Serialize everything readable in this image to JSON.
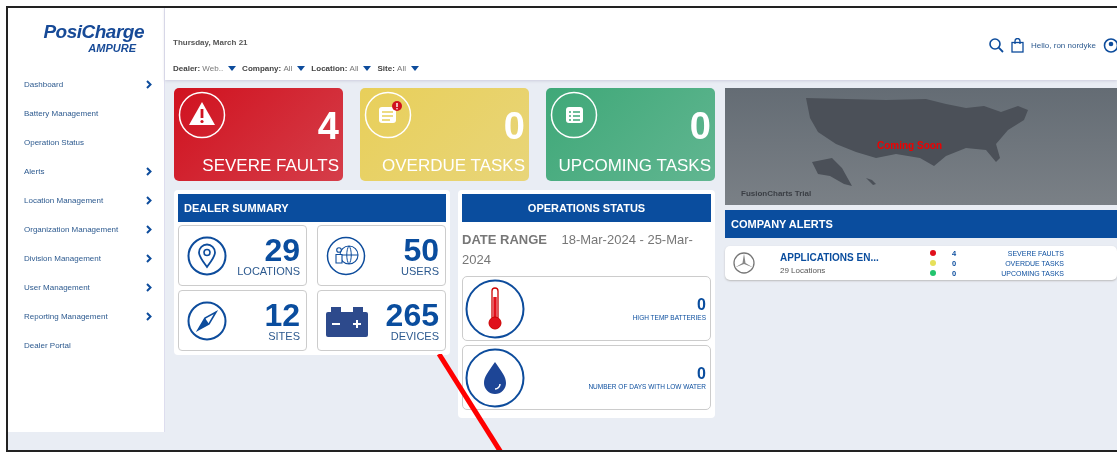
{
  "logo": {
    "brand": "PosiCharge",
    "sub": "AMPURE"
  },
  "sidebar": {
    "items": [
      {
        "label": "Dashboard",
        "expandable": true
      },
      {
        "label": "Battery Management",
        "expandable": false
      },
      {
        "label": "Operation Status",
        "expandable": false
      },
      {
        "label": "Alerts",
        "expandable": true
      },
      {
        "label": "Location Management",
        "expandable": true
      },
      {
        "label": "Organization Management",
        "expandable": true
      },
      {
        "label": "Division Management",
        "expandable": true
      },
      {
        "label": "User Management",
        "expandable": true
      },
      {
        "label": "Reporting Management",
        "expandable": true
      },
      {
        "label": "Dealer Portal",
        "expandable": false
      }
    ]
  },
  "header": {
    "date": "Thursday, March 21",
    "greeting": "Hello, ron nordyke",
    "filters": [
      {
        "label": "Dealer:",
        "value": "Web.."
      },
      {
        "label": "Company:",
        "value": "All"
      },
      {
        "label": "Location:",
        "value": "All"
      },
      {
        "label": "Site:",
        "value": "All"
      }
    ]
  },
  "tiles": [
    {
      "kind": "fault",
      "count": "4",
      "label": "SEVERE FAULTS",
      "color": "#d0121f"
    },
    {
      "kind": "overdue",
      "count": "0",
      "label": "OVERDUE TASKS",
      "color": "#e8cf5a"
    },
    {
      "kind": "upcoming",
      "count": "0",
      "label": "UPCOMING TASKS",
      "color": "#3fa878"
    }
  ],
  "dealer_summary": {
    "title": "DEALER SUMMARY",
    "stats": [
      {
        "kind": "location",
        "value": "29",
        "label": "LOCATIONS"
      },
      {
        "kind": "users",
        "value": "50",
        "label": "USERS"
      },
      {
        "kind": "site",
        "value": "12",
        "label": "SITES"
      },
      {
        "kind": "device",
        "value": "265",
        "label": "DEVICES"
      }
    ]
  },
  "operations_status": {
    "title": "OPERATIONS STATUS",
    "date_range_label": "DATE RANGE",
    "date_range_value": "18-Mar-2024 - 25-Mar-2024",
    "metrics": [
      {
        "kind": "temperature",
        "value": "0",
        "label": "HIGH TEMP BATTERIES"
      },
      {
        "kind": "water",
        "value": "0",
        "label": "NUMBER OF DAYS WITH LOW WATER"
      }
    ]
  },
  "map": {
    "message": "Coming Soon",
    "credit": "FusionCharts Trial"
  },
  "company_alerts": {
    "title": "COMPANY ALERTS",
    "rows": [
      {
        "name": "APPLICATIONS EN...",
        "locations": "29  Locations",
        "alerts": [
          {
            "color": "#e0101c",
            "count": "4",
            "label": "SEVERE FAULTS"
          },
          {
            "color": "#e6e05a",
            "count": "0",
            "label": "OVERDUE TASKS"
          },
          {
            "color": "#22c46e",
            "count": "0",
            "label": "UPCOMING TASKS"
          }
        ]
      }
    ]
  }
}
